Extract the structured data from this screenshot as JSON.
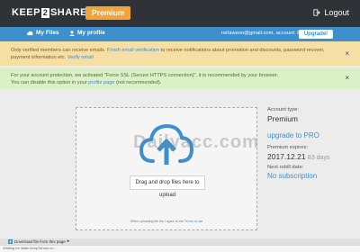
{
  "header": {
    "logo_left": "KEEP",
    "logo_mid": "2",
    "logo_right": "SHARE",
    "premium_label": "Premium",
    "logout_label": "Logout"
  },
  "nav": {
    "my_files": "My Files",
    "my_profile": "My profile",
    "account_info": "rorlawson@gmail.com, account: Premium",
    "upgrade_label": "Upgrade!"
  },
  "alerts": {
    "verified_part1": "Only verified members can receive emails.",
    "verified_link1": "Finish email verification",
    "verified_part2": "to receive notifications about promotion and discounts, password recover, payment information etc.",
    "verified_link2": "Verify email",
    "ssl_line1": "For your account protection, we activated \"Force SSL (Secure HTTPS connection)\", it is recommended by your browser.",
    "ssl_part2": "You can disable this option in your",
    "ssl_link": "profile page",
    "ssl_part3": "(not recommended).",
    "close": "×"
  },
  "upload": {
    "button_label": "Drag and drop files here to upload",
    "terms_prefix": "When uploading file file I agree to the",
    "terms_link": "Terms of use"
  },
  "account": {
    "type_label": "Account type:",
    "type_value": "Premium",
    "upgrade_link": "upgrade to PRO",
    "expires_label": "Premium expires:",
    "expires_value": "2017.12.21",
    "expires_days": "83 days",
    "rebill_label": "Next rebill date:",
    "rebill_value": "No subscription"
  },
  "watermark": "Dailyacc.com",
  "footer": {
    "download_label": "Download file from this page",
    "status": "Waiting for static.keep2share.cc..."
  },
  "colors": {
    "topbar": "#2f3236",
    "nav": "#3d90cc",
    "premium": "#f2a43a",
    "warning": "#f6dfa4",
    "success": "#dcf0c8"
  }
}
